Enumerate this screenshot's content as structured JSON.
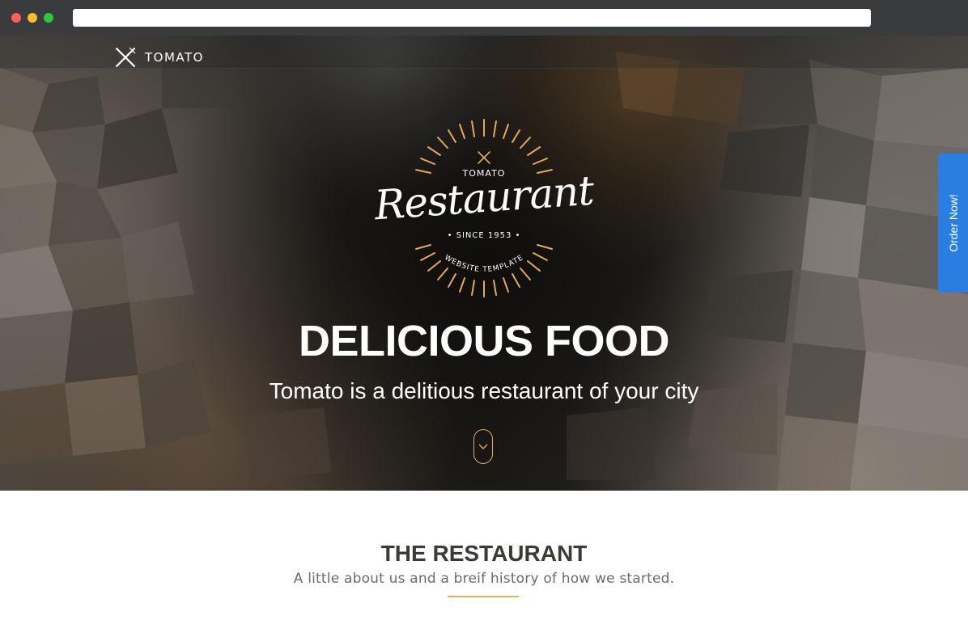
{
  "brand": {
    "name": "TOMATO"
  },
  "emblem": {
    "brand": "TOMATO",
    "title": "Restaurant",
    "since": "• SINCE 1953 •",
    "tagline": "WEBSITE TEMPLATE",
    "accent_color": "#e6a95a"
  },
  "hero": {
    "title": "DELICIOUS FOOD",
    "subtitle": "Tomato is a delitious restaurant of your city",
    "scroll_icon": "chevron-down-icon"
  },
  "order_tab": {
    "label": "Order Now!",
    "color": "#2a7de1"
  },
  "about": {
    "title": "THE RESTAURANT",
    "subtitle": "A little about us and a breif history of how we started.",
    "divider_color": "#e8b04f"
  }
}
